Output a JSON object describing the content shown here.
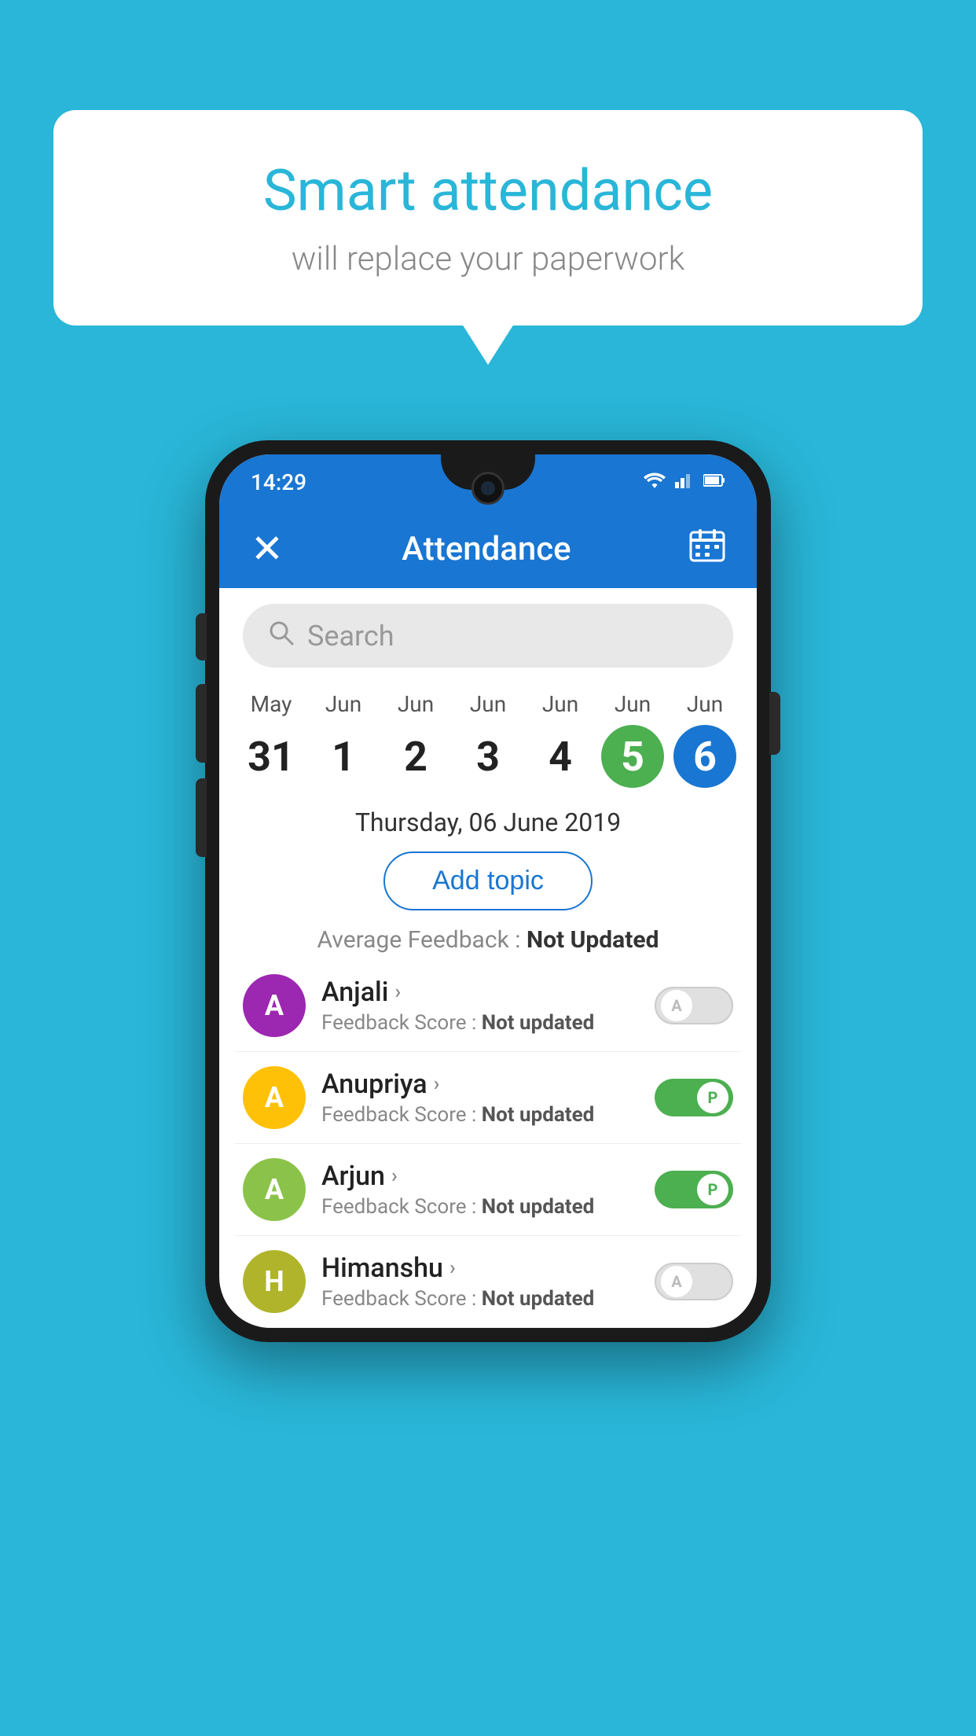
{
  "background_color": "#29b6d8",
  "bubble": {
    "title": "Smart attendance",
    "subtitle": "will replace your paperwork"
  },
  "status_bar": {
    "time": "14:29",
    "icons": [
      "wifi",
      "signal",
      "battery"
    ]
  },
  "app_bar": {
    "title": "Attendance",
    "close_label": "×",
    "calendar_icon": "📅"
  },
  "search": {
    "placeholder": "Search"
  },
  "calendar": {
    "dates": [
      {
        "month": "May",
        "day": "31",
        "state": "normal"
      },
      {
        "month": "Jun",
        "day": "1",
        "state": "normal"
      },
      {
        "month": "Jun",
        "day": "2",
        "state": "normal"
      },
      {
        "month": "Jun",
        "day": "3",
        "state": "normal"
      },
      {
        "month": "Jun",
        "day": "4",
        "state": "normal"
      },
      {
        "month": "Jun",
        "day": "5",
        "state": "today"
      },
      {
        "month": "Jun",
        "day": "6",
        "state": "selected"
      }
    ],
    "selected_date_label": "Thursday, 06 June 2019"
  },
  "add_topic_button": "Add topic",
  "avg_feedback": {
    "label": "Average Feedback : ",
    "value": "Not Updated"
  },
  "students": [
    {
      "name": "Anjali",
      "avatar_letter": "A",
      "avatar_color": "purple",
      "feedback": "Feedback Score : ",
      "feedback_value": "Not updated",
      "toggle": "off",
      "toggle_label": "A"
    },
    {
      "name": "Anupriya",
      "avatar_letter": "A",
      "avatar_color": "yellow",
      "feedback": "Feedback Score : ",
      "feedback_value": "Not updated",
      "toggle": "on",
      "toggle_label": "P"
    },
    {
      "name": "Arjun",
      "avatar_letter": "A",
      "avatar_color": "green",
      "feedback": "Feedback Score : ",
      "feedback_value": "Not updated",
      "toggle": "on",
      "toggle_label": "P"
    },
    {
      "name": "Himanshu",
      "avatar_letter": "H",
      "avatar_color": "olive",
      "feedback": "Feedback Score : ",
      "feedback_value": "Not updated",
      "toggle": "off",
      "toggle_label": "A"
    }
  ]
}
